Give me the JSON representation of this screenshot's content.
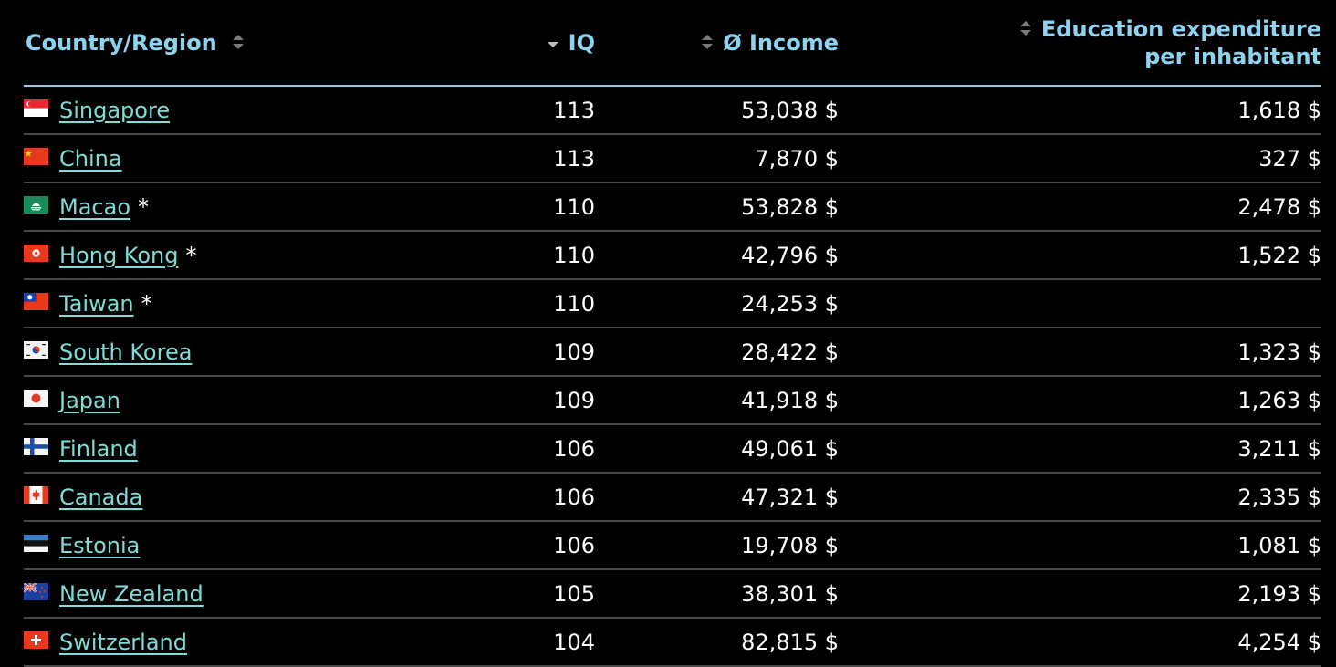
{
  "table": {
    "headers": {
      "country": "Country/Region",
      "iq": "IQ",
      "income": "Ø Income",
      "education_line1": "Education expenditure",
      "education_line2": "per inhabitant"
    },
    "rows": [
      {
        "country": "Singapore",
        "flag": "singapore-flag",
        "note": "",
        "iq": "113",
        "income": "53,038 $",
        "education": "1,618 $"
      },
      {
        "country": "China",
        "flag": "china-flag",
        "note": "",
        "iq": "113",
        "income": "7,870 $",
        "education": "327 $"
      },
      {
        "country": "Macao",
        "flag": "macao-flag",
        "note": "*",
        "iq": "110",
        "income": "53,828 $",
        "education": "2,478 $"
      },
      {
        "country": "Hong Kong",
        "flag": "hong-kong-flag",
        "note": "*",
        "iq": "110",
        "income": "42,796 $",
        "education": "1,522 $"
      },
      {
        "country": "Taiwan",
        "flag": "taiwan-flag",
        "note": "*",
        "iq": "110",
        "income": "24,253 $",
        "education": ""
      },
      {
        "country": "South Korea",
        "flag": "south-korea-flag",
        "note": "",
        "iq": "109",
        "income": "28,422 $",
        "education": "1,323 $"
      },
      {
        "country": "Japan",
        "flag": "japan-flag",
        "note": "",
        "iq": "109",
        "income": "41,918 $",
        "education": "1,263 $"
      },
      {
        "country": "Finland",
        "flag": "finland-flag",
        "note": "",
        "iq": "106",
        "income": "49,061 $",
        "education": "3,211 $"
      },
      {
        "country": "Canada",
        "flag": "canada-flag",
        "note": "",
        "iq": "106",
        "income": "47,321 $",
        "education": "2,335 $"
      },
      {
        "country": "Estonia",
        "flag": "estonia-flag",
        "note": "",
        "iq": "106",
        "income": "19,708 $",
        "education": "1,081 $"
      },
      {
        "country": "New Zealand",
        "flag": "new-zealand-flag",
        "note": "",
        "iq": "105",
        "income": "38,301 $",
        "education": "2,193 $"
      },
      {
        "country": "Switzerland",
        "flag": "switzerland-flag",
        "note": "",
        "iq": "104",
        "income": "82,815 $",
        "education": "4,254 $"
      }
    ]
  },
  "icons": {
    "sort_neutral": "sort-both-icon",
    "sort_desc": "sort-descending-icon"
  },
  "colors": {
    "background": "#000000",
    "header_text": "#8ed4f0",
    "link": "#7fdcd6",
    "row_divider": "#4a4a4a",
    "header_divider": "#8fc9e6"
  }
}
